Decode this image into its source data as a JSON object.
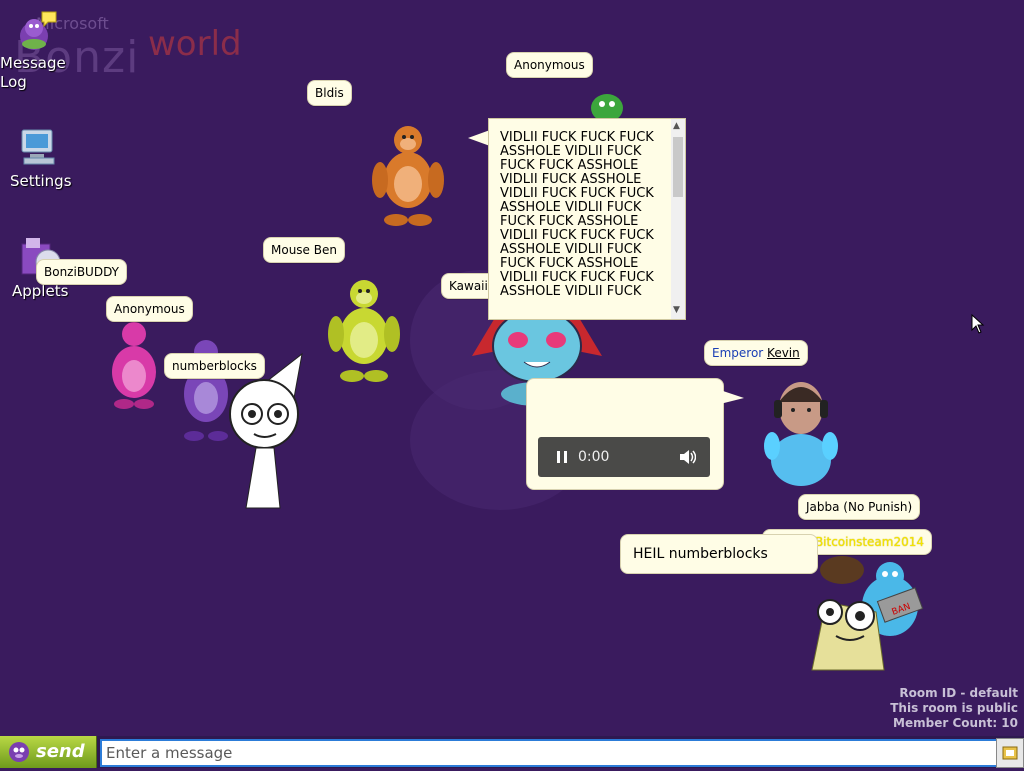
{
  "logo": {
    "small_text": "Microsoft",
    "main_text": "Bonzi",
    "suffix_text": "world"
  },
  "desktop": {
    "icons": [
      {
        "label_line1": "Message",
        "label_line2": "Log",
        "icon": "bonzi-message-icon"
      },
      {
        "label_line1": "Settings",
        "label_line2": "",
        "icon": "computer-settings-icon"
      },
      {
        "label_line1": "Applets",
        "label_line2": "",
        "icon": "applets-box-icon"
      }
    ]
  },
  "users": {
    "anonymous_top": "Anonymous",
    "bldis": "Bldis",
    "bonzibuddy": "BonziBUDDY",
    "mouse_ben": "Mouse Ben",
    "anonymous_left": "Anonymous",
    "numberblocks": "numberblocks",
    "kawaii": "Kawaii",
    "emperor_prefix": "Emperor",
    "emperor_name": "Kevin",
    "jabba": "Jabba (No Punish)",
    "yellow_user": "BoTimeBitcoinsteam2014"
  },
  "messages": {
    "spam": "VIDLII FUCK FUCK FUCK ASSHOLE VIDLII FUCK FUCK FUCK ASSHOLE VIDLII FUCK ASSHOLE VIDLII FUCK FUCK FUCK ASSHOLE VIDLII FUCK FUCK FUCK ASSHOLE VIDLII FUCK FUCK FUCK ASSHOLE VIDLII FUCK FUCK FUCK ASSHOLE VIDLII FUCK FUCK FUCK ASSHOLE VIDLII FUCK",
    "heil": "HEIL numberblocks",
    "audio_time": "0:00"
  },
  "room": {
    "id_line": "Room ID - default",
    "public_line": "This room is public",
    "count_line": "Member Count: 10"
  },
  "chat": {
    "send_label": "send",
    "placeholder": "Enter a message"
  },
  "colors": {
    "background": "#3a1b5e",
    "bubble": "#fffde6",
    "send_button": "#8fb52c",
    "input_border": "#2c7cd8"
  }
}
